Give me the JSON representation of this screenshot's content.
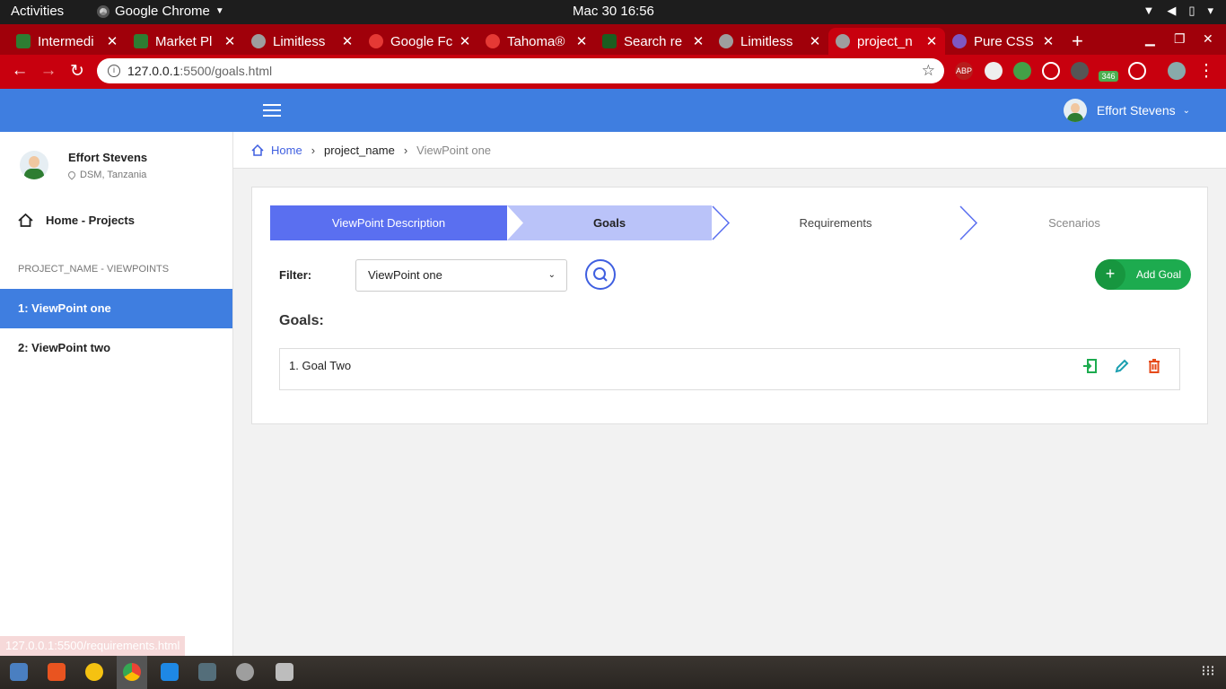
{
  "system_bar": {
    "activities": "Activities",
    "app_name": "Google Chrome",
    "datetime": "Mac 30  16:56"
  },
  "browser": {
    "tabs": [
      {
        "title": "Intermedi",
        "favicon_color": "#2e7d32"
      },
      {
        "title": "Market Pl",
        "favicon_color": "#2e7d32"
      },
      {
        "title": "Limitless",
        "favicon_color": "#9e9e9e"
      },
      {
        "title": "Google Fc",
        "favicon_color": "#e53935"
      },
      {
        "title": "Tahoma®",
        "favicon_color": "#e53935"
      },
      {
        "title": "Search re",
        "favicon_color": "#1b5e20"
      },
      {
        "title": "Limitless",
        "favicon_color": "#9e9e9e"
      },
      {
        "title": "project_n",
        "favicon_color": "#9e9e9e"
      },
      {
        "title": "Pure CSS",
        "favicon_color": "#7e57c2"
      }
    ],
    "active_tab_index": 7,
    "url_host": "127.0.0.1",
    "url_path": ":5500/goals.html",
    "ext_badge": "346",
    "ext_abp": "ABP",
    "status_url": "127.0.0.1:5500/requirements.html"
  },
  "app": {
    "header_user": "Effort Stevens",
    "profile": {
      "name": "Effort Stevens",
      "location": "DSM, Tanzania"
    },
    "nav_home": "Home - Projects",
    "section_label": "PROJECT_NAME - VIEWPOINTS",
    "viewpoints": [
      "1: ViewPoint one",
      "2: ViewPoint two"
    ],
    "active_viewpoint_index": 0,
    "breadcrumb": {
      "home": "Home",
      "project": "project_name",
      "current": "ViewPoint one"
    },
    "steps": [
      "ViewPoint Description",
      "Goals",
      "Requirements",
      "Scenarios"
    ],
    "active_step_index": 1,
    "filter_label": "Filter:",
    "filter_value": "ViewPoint one",
    "add_goal": "Add Goal",
    "goals_title": "Goals:",
    "goals": [
      "1. Goal Two"
    ]
  },
  "colors": {
    "header_blue": "#3f7ee0",
    "step_active": "#5a6ff0",
    "step_current": "#bac3f9",
    "add_goal_green": "#1dab4f",
    "chrome_red": "#c8000e"
  }
}
